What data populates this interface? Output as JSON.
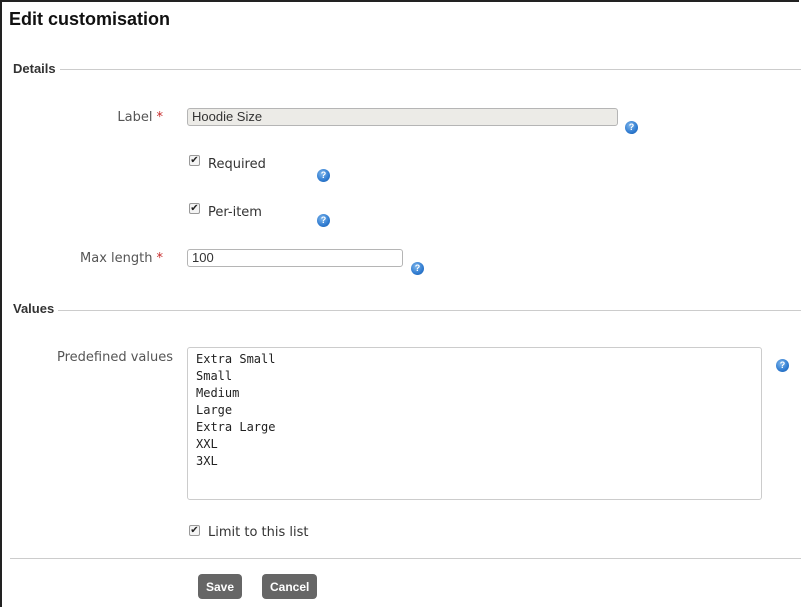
{
  "page": {
    "title": "Edit customisation"
  },
  "details": {
    "legend": "Details",
    "label_field": {
      "label": "Label",
      "required_marker": "*",
      "value": "Hoodie Size"
    },
    "required_checkbox": {
      "label": "Required",
      "checked": true
    },
    "per_item_checkbox": {
      "label": "Per-item",
      "checked": true
    },
    "max_length_field": {
      "label": "Max length",
      "required_marker": "*",
      "value": "100"
    }
  },
  "values": {
    "legend": "Values",
    "predefined": {
      "label": "Predefined values",
      "items": [
        "Extra Small",
        "Small",
        "Medium",
        "Large",
        "Extra Large",
        "XXL",
        "3XL"
      ]
    },
    "limit_checkbox": {
      "label": "Limit to this list",
      "checked": true
    }
  },
  "actions": {
    "save_label": "Save",
    "cancel_label": "Cancel"
  },
  "icons": {
    "help": "help-icon",
    "check": "✔"
  },
  "colors": {
    "required": "#c62828",
    "help": "#2f7bd0",
    "button": "#666666"
  }
}
